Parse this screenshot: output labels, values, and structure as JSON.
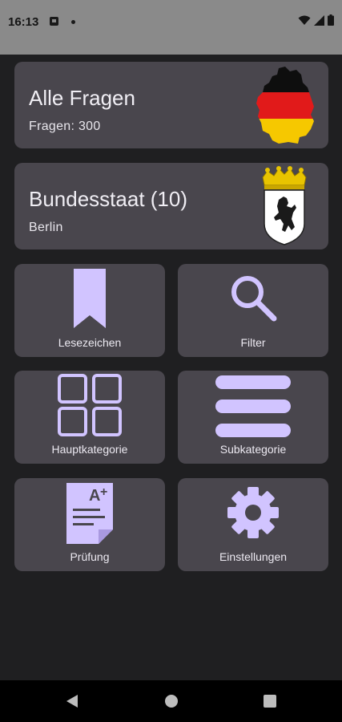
{
  "status_bar": {
    "time": "16:13",
    "icons": [
      "notification-icon",
      "wifi-icon",
      "signal-icon",
      "battery-icon"
    ]
  },
  "cards": {
    "all_questions": {
      "title": "Alle Fragen",
      "subtitle": "Fragen: 300",
      "icon": "germany-flag-map-icon"
    },
    "federal_state": {
      "title": "Bundesstaat (10)",
      "subtitle": "Berlin",
      "icon": "berlin-coat-of-arms-icon"
    }
  },
  "tiles": {
    "bookmarks": {
      "label": "Lesezeichen",
      "icon": "bookmark-icon"
    },
    "filter": {
      "label": "Filter",
      "icon": "search-icon"
    },
    "main_category": {
      "label": "Hauptkategorie",
      "icon": "grid-icon"
    },
    "sub_category": {
      "label": "Subkategorie",
      "icon": "list-icon"
    },
    "exam": {
      "label": "Prüfung",
      "icon": "graded-document-icon"
    },
    "settings": {
      "label": "Einstellungen",
      "icon": "gear-icon"
    }
  },
  "colors": {
    "background": "#1f1f21",
    "card": "#49464d",
    "accent": "#d1c4ff",
    "text": "#f0eef4",
    "status_bar": "#8a8a8a"
  },
  "nav_bar": {
    "buttons": [
      "back-icon",
      "home-icon",
      "recents-icon"
    ]
  }
}
